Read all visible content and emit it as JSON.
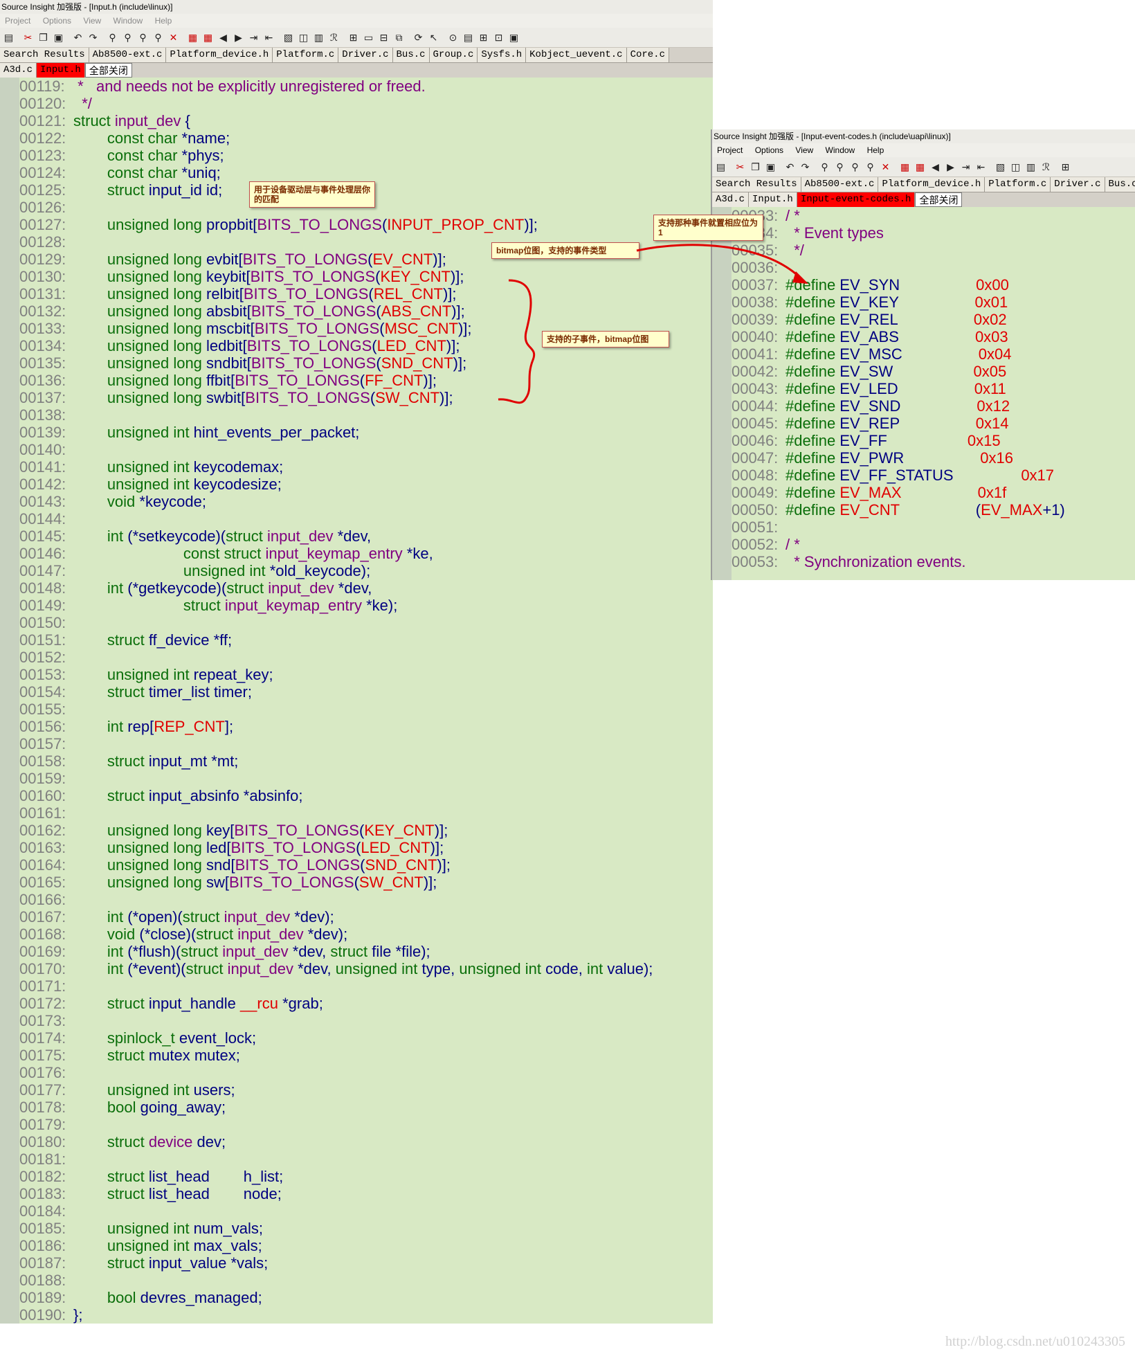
{
  "window1": {
    "title": "Source Insight 加强版 - [Input.h (include\\linux)]",
    "menu": [
      "Project",
      "Options",
      "View",
      "Window",
      "Help"
    ],
    "tabs_row1": [
      "Search Results",
      "Ab8500-ext.c",
      "Platform_device.h",
      "Platform.c",
      "Driver.c",
      "Bus.c",
      "Group.c",
      "Sysfs.h",
      "Kobject_uevent.c",
      "Core.c"
    ],
    "tabs_row2": [
      "A3d.c",
      "Input.h",
      "全部关闭"
    ],
    "active_tab": "Input.h",
    "lines": [
      [
        "00119:",
        " *   and needs not be explicitly unregistered or freed."
      ],
      [
        "00120:",
        "  */"
      ],
      [
        "00121:",
        "struct input_dev {"
      ],
      [
        "00122:",
        "        const char *name;"
      ],
      [
        "00123:",
        "        const char *phys;"
      ],
      [
        "00124:",
        "        const char *uniq;"
      ],
      [
        "00125:",
        "        struct input_id id;"
      ],
      [
        "00126:",
        ""
      ],
      [
        "00127:",
        "        unsigned long propbit[BITS_TO_LONGS(INPUT_PROP_CNT)];"
      ],
      [
        "00128:",
        ""
      ],
      [
        "00129:",
        "        unsigned long evbit[BITS_TO_LONGS(EV_CNT)];"
      ],
      [
        "00130:",
        "        unsigned long keybit[BITS_TO_LONGS(KEY_CNT)];"
      ],
      [
        "00131:",
        "        unsigned long relbit[BITS_TO_LONGS(REL_CNT)];"
      ],
      [
        "00132:",
        "        unsigned long absbit[BITS_TO_LONGS(ABS_CNT)];"
      ],
      [
        "00133:",
        "        unsigned long mscbit[BITS_TO_LONGS(MSC_CNT)];"
      ],
      [
        "00134:",
        "        unsigned long ledbit[BITS_TO_LONGS(LED_CNT)];"
      ],
      [
        "00135:",
        "        unsigned long sndbit[BITS_TO_LONGS(SND_CNT)];"
      ],
      [
        "00136:",
        "        unsigned long ffbit[BITS_TO_LONGS(FF_CNT)];"
      ],
      [
        "00137:",
        "        unsigned long swbit[BITS_TO_LONGS(SW_CNT)];"
      ],
      [
        "00138:",
        ""
      ],
      [
        "00139:",
        "        unsigned int hint_events_per_packet;"
      ],
      [
        "00140:",
        ""
      ],
      [
        "00141:",
        "        unsigned int keycodemax;"
      ],
      [
        "00142:",
        "        unsigned int keycodesize;"
      ],
      [
        "00143:",
        "        void *keycode;"
      ],
      [
        "00144:",
        ""
      ],
      [
        "00145:",
        "        int (*setkeycode)(struct input_dev *dev,"
      ],
      [
        "00146:",
        "                          const struct input_keymap_entry *ke,"
      ],
      [
        "00147:",
        "                          unsigned int *old_keycode);"
      ],
      [
        "00148:",
        "        int (*getkeycode)(struct input_dev *dev,"
      ],
      [
        "00149:",
        "                          struct input_keymap_entry *ke);"
      ],
      [
        "00150:",
        ""
      ],
      [
        "00151:",
        "        struct ff_device *ff;"
      ],
      [
        "00152:",
        ""
      ],
      [
        "00153:",
        "        unsigned int repeat_key;"
      ],
      [
        "00154:",
        "        struct timer_list timer;"
      ],
      [
        "00155:",
        ""
      ],
      [
        "00156:",
        "        int rep[REP_CNT];"
      ],
      [
        "00157:",
        ""
      ],
      [
        "00158:",
        "        struct input_mt *mt;"
      ],
      [
        "00159:",
        ""
      ],
      [
        "00160:",
        "        struct input_absinfo *absinfo;"
      ],
      [
        "00161:",
        ""
      ],
      [
        "00162:",
        "        unsigned long key[BITS_TO_LONGS(KEY_CNT)];"
      ],
      [
        "00163:",
        "        unsigned long led[BITS_TO_LONGS(LED_CNT)];"
      ],
      [
        "00164:",
        "        unsigned long snd[BITS_TO_LONGS(SND_CNT)];"
      ],
      [
        "00165:",
        "        unsigned long sw[BITS_TO_LONGS(SW_CNT)];"
      ],
      [
        "00166:",
        ""
      ],
      [
        "00167:",
        "        int (*open)(struct input_dev *dev);"
      ],
      [
        "00168:",
        "        void (*close)(struct input_dev *dev);"
      ],
      [
        "00169:",
        "        int (*flush)(struct input_dev *dev, struct file *file);"
      ],
      [
        "00170:",
        "        int (*event)(struct input_dev *dev, unsigned int type, unsigned int code, int value);"
      ],
      [
        "00171:",
        ""
      ],
      [
        "00172:",
        "        struct input_handle __rcu *grab;"
      ],
      [
        "00173:",
        ""
      ],
      [
        "00174:",
        "        spinlock_t event_lock;"
      ],
      [
        "00175:",
        "        struct mutex mutex;"
      ],
      [
        "00176:",
        ""
      ],
      [
        "00177:",
        "        unsigned int users;"
      ],
      [
        "00178:",
        "        bool going_away;"
      ],
      [
        "00179:",
        ""
      ],
      [
        "00180:",
        "        struct device dev;"
      ],
      [
        "00181:",
        ""
      ],
      [
        "00182:",
        "        struct list_head        h_list;"
      ],
      [
        "00183:",
        "        struct list_head        node;"
      ],
      [
        "00184:",
        ""
      ],
      [
        "00185:",
        "        unsigned int num_vals;"
      ],
      [
        "00186:",
        "        unsigned int max_vals;"
      ],
      [
        "00187:",
        "        struct input_value *vals;"
      ],
      [
        "00188:",
        ""
      ],
      [
        "00189:",
        "        bool devres_managed;"
      ],
      [
        "00190:",
        "};"
      ]
    ]
  },
  "window2": {
    "title": "Source Insight 加强版 - [Input-event-codes.h (include\\uapi\\linux)]",
    "menu": [
      "Project",
      "Options",
      "View",
      "Window",
      "Help"
    ],
    "tabs_row1": [
      "Search Results",
      "Ab8500-ext.c",
      "Platform_device.h",
      "Platform.c",
      "Driver.c",
      "Bus.c"
    ],
    "tabs_row2": [
      "A3d.c",
      "Input.h",
      "Input-event-codes.h",
      "全部关闭"
    ],
    "active_tab": "Input-event-codes.h",
    "lines": [
      [
        "00033:",
        "/ *"
      ],
      [
        "00034:",
        "  * Event types"
      ],
      [
        "00035:",
        "  */"
      ],
      [
        "00036:",
        ""
      ],
      [
        "00037:",
        "#define EV_SYN                  0x00"
      ],
      [
        "00038:",
        "#define EV_KEY                  0x01"
      ],
      [
        "00039:",
        "#define EV_REL                  0x02"
      ],
      [
        "00040:",
        "#define EV_ABS                  0x03"
      ],
      [
        "00041:",
        "#define EV_MSC                  0x04"
      ],
      [
        "00042:",
        "#define EV_SW                   0x05"
      ],
      [
        "00043:",
        "#define EV_LED                  0x11"
      ],
      [
        "00044:",
        "#define EV_SND                  0x12"
      ],
      [
        "00045:",
        "#define EV_REP                  0x14"
      ],
      [
        "00046:",
        "#define EV_FF                   0x15"
      ],
      [
        "00047:",
        "#define EV_PWR                  0x16"
      ],
      [
        "00048:",
        "#define EV_FF_STATUS                0x17"
      ],
      [
        "00049:",
        "#define EV_MAX                  0x1f"
      ],
      [
        "00050:",
        "#define EV_CNT                  (EV_MAX+1)"
      ],
      [
        "00051:",
        ""
      ],
      [
        "00052:",
        "/ *"
      ],
      [
        "00053:",
        "  * Synchronization events."
      ]
    ]
  },
  "annotations": {
    "match": "用于设备驱动层与事件处理层你的匹配",
    "ev_bitmap": "bitmap位图，支持的事件类型",
    "sub_events": "支持的子事件，bitmap位图",
    "set_bit": "支持那种事件就置相应位为1"
  },
  "watermark": "http://blog.csdn.net/u010243305"
}
